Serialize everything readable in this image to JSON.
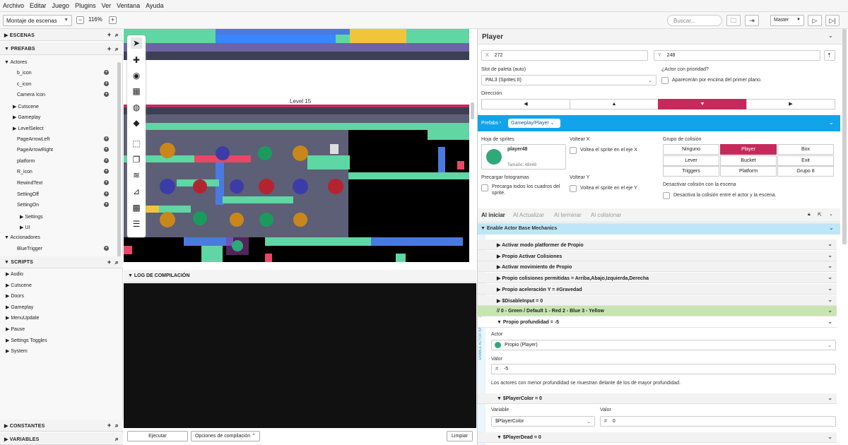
{
  "menu": [
    "Archivo",
    "Editar",
    "Juego",
    "Plugins",
    "Ver",
    "Ventana",
    "Ayuda"
  ],
  "toolbar": {
    "view_mode": "Montaje de escenas",
    "zoom": "116%",
    "search_placeholder": "Buscar...",
    "build_target": "Master"
  },
  "left": {
    "scenes_label": "ESCENAS",
    "prefabs_label": "PREFABS",
    "actors_folder": "Actores",
    "actors": [
      "b_icon",
      "c_icon",
      "Camera Icon",
      "Cutscene",
      "Gameplay",
      "LevelSelect",
      "PageArrowLeft",
      "PageArrowRight",
      "platform",
      "R_icon",
      "RewindText",
      "SettingOff",
      "SettingOn",
      "Settings",
      "UI"
    ],
    "triggers_folder": "Accionadores",
    "triggers": [
      "BlueTrigger"
    ],
    "scripts_label": "SCRIPTS",
    "scripts": [
      "Audio",
      "Cutscene",
      "Doors",
      "Gameplay",
      "MenuUpdate",
      "Pause",
      "Settings Toggles",
      "System"
    ],
    "constants_label": "CONSTANTES",
    "variables_label": "VARIABLES"
  },
  "canvas": {
    "scene_name": "Level 15"
  },
  "log": {
    "title": "LOG DE COMPILACIÓN",
    "run": "Ejecutar",
    "options": "Opciones de compilación",
    "clear": "Limpiar"
  },
  "actor": {
    "name": "Player",
    "x_label": "X",
    "x": "272",
    "y_label": "Y",
    "y": "248",
    "palette_label": "Slot de paleta (auto)",
    "palette": "PAL3 (Sprites II)",
    "priority_label": "¿Actor con prioridad?",
    "priority_text": "Aparecerán por encima del primer plano.",
    "direction_label": "Dirección",
    "prefab_crumb": "Prefabs",
    "prefab_name": "Gameplay/Player",
    "sheet_label": "Hoja de sprites",
    "sprite_name": "player48",
    "sprite_size": "Tamaño: 48x48",
    "flipx_label": "Voltear X",
    "flipx_text": "Voltea el sprite en el eje X",
    "flipy_label": "Voltear Y",
    "flipy_text": "Voltea el sprite en el eje Y",
    "preload_label": "Precargar fotogramas",
    "preload_text": "Precarga todos los cuadros del sprite.",
    "collision_label": "Grupo de colisión",
    "collision_groups": [
      "Ninguno",
      "Player",
      "Box",
      "Lever",
      "Bucket",
      "Exit",
      "Triggers",
      "Platform",
      "Grupo 8"
    ],
    "disable_col_label": "Desactivar colisión con la escena",
    "disable_col_text": "Desactiva la colisión entre el actor y la escena."
  },
  "tabs": [
    "Al iniciar",
    "Al Actualizar",
    "Al terminar",
    "Al colisionar"
  ],
  "events": {
    "group": "Enable Actor Base Mechanics",
    "side_label": "ENABLE ACTOR BASE MECHANICS",
    "rows": [
      "Activar modo platformer de Propio",
      "Propio Activar Colisiones",
      "Activar movimiento de Propio",
      "Propio colisiones permitidas = Arriba,Abajo,Izquierda,Derecha",
      "Propio aceleración Y = #Gravedad",
      "$DisableInput = 0"
    ],
    "comment": "//  0 - Green / Default 1 - Red 2 - Blue 3 - Yellow",
    "depth_title": "Propio profundidad = -5",
    "actor_label": "Actor",
    "actor_value": "Propio (Player)",
    "value_label": "Valor",
    "value": "-5",
    "depth_help": "Los actores con menor profundidad se muestran delante de los de mayor profundidad.",
    "pc_title": "$PlayerColor = 0",
    "var_label": "Variable",
    "var_value": "$PlayerColor",
    "var_val_label": "Valor",
    "var_val": "0",
    "dead_title": "$PlayerDead = 0"
  },
  "colors": {
    "accent": "#c62a5c",
    "prefab_bar": "#12a4ea",
    "group_bar": "#bfe6f6",
    "comment_bar": "#c7e5b0"
  }
}
